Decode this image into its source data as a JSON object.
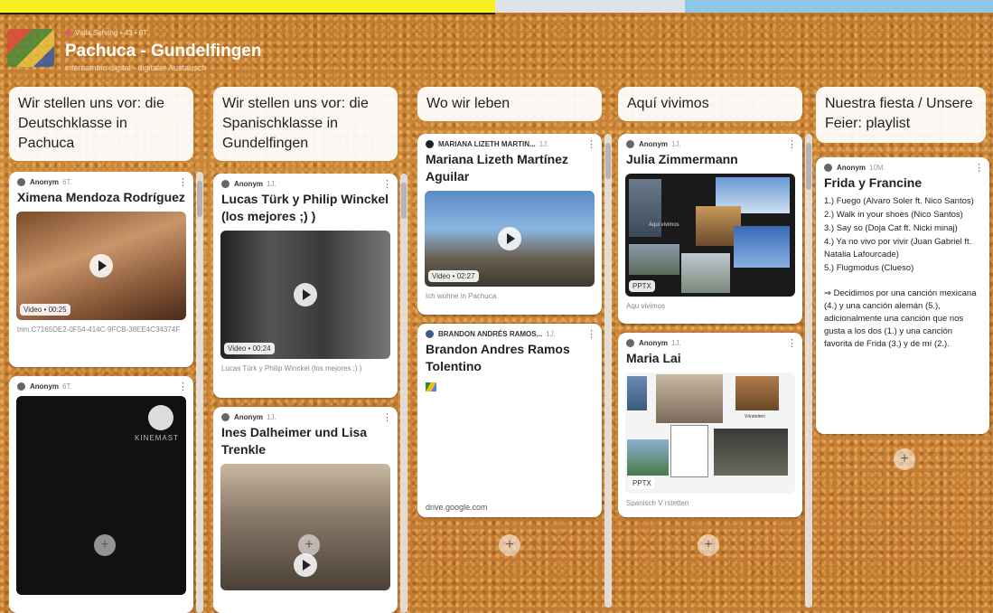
{
  "header": {
    "meta": "Viola Sehring • 43 • 6T",
    "title": "Pachuca - Gundelfingen",
    "subtitle": "intercambio digital - digitaler Austausch"
  },
  "columns": [
    {
      "title": "Wir stellen uns vor: die Deutschklasse in Pachuca"
    },
    {
      "title": "Wir stellen uns vor: die Spanischklasse in Gundelfingen"
    },
    {
      "title": "Wo wir leben"
    },
    {
      "title": "Aquí vivimos"
    },
    {
      "title": "Nuestra fiesta / Unsere Feier: playlist"
    }
  ],
  "cards": {
    "c1a": {
      "author": "Anonym",
      "time": "6T.",
      "title": "Ximena Mendoza Rodríguez",
      "tag": "Video • 00:25",
      "caption": "trim.C7165DE2-0F54-414C-9FCB-38EE4C34374F"
    },
    "c1b": {
      "author": "Anonym",
      "time": "6T.",
      "brand": "KINEMAST"
    },
    "c2a": {
      "author": "Anonym",
      "time": "1J.",
      "title": "Lucas Türk y Philip Winckel (los mejores ;) )",
      "tag": "Video • 00:24",
      "caption": "Lucas Türk y Philip Winckel (los mejores ;) )"
    },
    "c2b": {
      "author": "Anonym",
      "time": "1J.",
      "title": "Ines Dalheimer und Lisa Trenkle"
    },
    "c3a": {
      "author": "MARIANA LIZETH MARTIN...",
      "time": "1J.",
      "title": "Mariana Lizeth Martínez Aguilar",
      "tag": "Video • 02:27",
      "caption": "Ich wohne in Pachuca"
    },
    "c3b": {
      "author": "BRANDON ANDRÉS RAMOS...",
      "time": "1J.",
      "title": "Brandon Andres Ramos Tolentino",
      "link": "drive.google.com"
    },
    "c4a": {
      "author": "Anonym",
      "time": "1J.",
      "title": "Julia Zimmermann",
      "tag": "PPTX",
      "caption": "Aqu vivimos",
      "slide_text": "Aqui vivimos"
    },
    "c4b": {
      "author": "Anonym",
      "time": "1J.",
      "title": "Maria Lai",
      "tag": "PPTX",
      "caption": "Spanisch V rstetten",
      "slide_text": "Vörstetten"
    },
    "c5a": {
      "author": "Anonym",
      "time": "10M.",
      "title": "Frida y Francine",
      "lines": [
        "1.) Fuego (Alvaro Soler ft. Nico Santos)",
        "2.) Walk in your shoes (Nico Santos)",
        "3.) Say so (Doja Cat ft. Nicki minaj)",
        "4.) Ya no vivo por vivir (Juan Gabriel ft. Natalia Lafourcade)",
        "5.) Flugmodus (Clueso)"
      ],
      "note": "⇒ Decidimos por una canción mexicana (4.) y una canción alemán (5.), adicionalmente una canción que nos gusta a los dos (1.) y una canción favorita de Frida (3.) y de mí (2.)."
    }
  },
  "add_label": "+",
  "colors": {
    "board": "#c98433",
    "card": "#ffffff",
    "banner": "#f7ef22"
  }
}
